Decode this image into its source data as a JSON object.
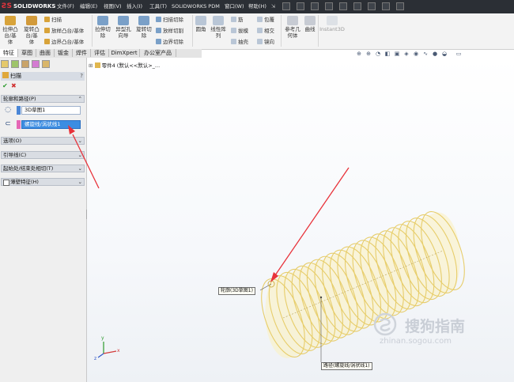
{
  "app": {
    "logo": "SOLIDWORKS",
    "menus": [
      "文件(F)",
      "编辑(E)",
      "视图(V)",
      "插入(I)",
      "工具(T)",
      "SOLIDWORKS PDM",
      "窗口(W)",
      "帮助(H)"
    ]
  },
  "ribbon": {
    "extrude_boss": "拉伸凸\n台/基\n体",
    "revolve_boss": "旋转凸\n台/基\n体",
    "sweep": "扫描",
    "loft_boss": "放样凸台/基体",
    "boundary_boss": "边界凸台/基体",
    "extrude_cut": "拉伸切\n除",
    "hole_wizard": "异型孔\n向导",
    "revolve_cut": "旋转切\n除",
    "swept_cut": "扫描切除",
    "loft_cut": "放样切割",
    "boundary_cut": "边界切除",
    "fillet": "圆角",
    "linear_pattern": "线性阵\n列",
    "rib": "筋",
    "draft": "拔模",
    "shell": "抽壳",
    "wrap": "包覆",
    "intersect": "相交",
    "mirror": "镜向",
    "ref_geometry": "参考几\n何体",
    "curves": "曲线",
    "instant3d": "Instant3D"
  },
  "tabs": [
    "特征",
    "草图",
    "曲面",
    "钣金",
    "焊件",
    "评估",
    "DimXpert",
    "办公室产品"
  ],
  "tree": {
    "part_label": "零件4 (默认<<默认>_..."
  },
  "property_manager": {
    "title": "扫描",
    "help": "?",
    "ok": "✔",
    "cancel": "✖",
    "sections": {
      "profile_path": "轮廓和路径(P)",
      "options": "选项(O)",
      "guide_curves": "引导线(C)",
      "start_end": "起始处/结束处相切(T)",
      "thin_feature": "薄壁特征(H)"
    },
    "profile_field": "3D草图1",
    "path_field": "螺旋线/涡状线1"
  },
  "graphics": {
    "callout_profile": "轮廓(3D草图1)",
    "callout_path": "路径(螺旋线/涡状线1)",
    "triad_x": "x",
    "triad_y": "y",
    "triad_z": "z"
  },
  "watermark": {
    "cn": "搜狗指南",
    "url": "zhinan.sogou.com"
  },
  "colors": {
    "titlebar": "#2b2f35",
    "accent_red": "#e8323a",
    "coil": "#e7cd6a",
    "coil_fill": "#fbf1bd",
    "selection_blue": "#3c8de2",
    "arrow": "#e8323a"
  },
  "icons": {
    "view_toolbar": [
      "zoom-fit-icon",
      "zoom-area-icon",
      "prev-view-icon",
      "section-view-icon",
      "dynamic-annotation-icon",
      "view-orientation-icon",
      "display-style-icon",
      "hide-show-icon",
      "edit-appearance-icon",
      "apply-scene-icon",
      "view-settings-icon"
    ]
  }
}
